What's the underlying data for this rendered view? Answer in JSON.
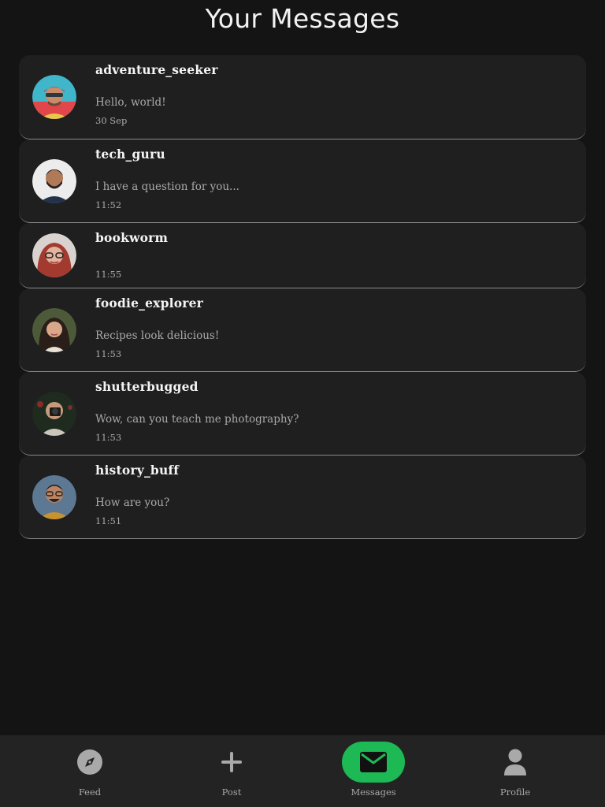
{
  "header": {
    "title": "Your Messages"
  },
  "conversations": [
    {
      "username": "adventure_seeker",
      "preview": "Hello, world!",
      "time": "30 Sep",
      "avatar_icon": "adventure-seeker-avatar"
    },
    {
      "username": "tech_guru",
      "preview": "I have a question for you...",
      "time": "11:52",
      "avatar_icon": "tech-guru-avatar"
    },
    {
      "username": "bookworm",
      "preview": "",
      "time": "11:55",
      "avatar_icon": "bookworm-avatar"
    },
    {
      "username": "foodie_explorer",
      "preview": "Recipes look delicious!",
      "time": "11:53",
      "avatar_icon": "foodie-explorer-avatar"
    },
    {
      "username": "shutterbugged",
      "preview": "Wow, can you teach me photography?",
      "time": "11:53",
      "avatar_icon": "shutterbugged-avatar"
    },
    {
      "username": "history_buff",
      "preview": "How are you?",
      "time": "11:51",
      "avatar_icon": "history-buff-avatar"
    }
  ],
  "nav": {
    "items": [
      {
        "label": "Feed",
        "icon": "compass-icon",
        "active": false
      },
      {
        "label": "Post",
        "icon": "plus-icon",
        "active": false
      },
      {
        "label": "Messages",
        "icon": "envelope-icon",
        "active": true
      },
      {
        "label": "Profile",
        "icon": "person-icon",
        "active": false
      }
    ]
  },
  "colors": {
    "background": "#141414",
    "card": "#1f1f20",
    "nav_bar": "#232323",
    "accent": "#1db954",
    "text_primary": "#f4f4f4",
    "text_secondary": "#a9a9a9"
  }
}
